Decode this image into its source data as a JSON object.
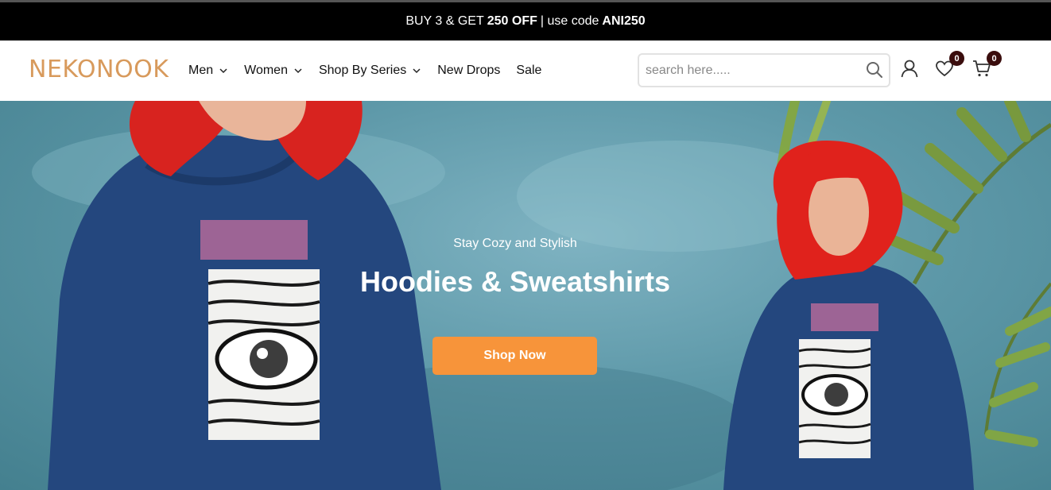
{
  "announcement": {
    "part1": "BUY 3 & GET",
    "bold1": "250 OFF",
    "part2": "| use code",
    "bold2": "ANI250"
  },
  "brand": {
    "logo_text": "NEKONOOK",
    "logo_color": "#d89a5c"
  },
  "nav": {
    "items": [
      {
        "label": "Men",
        "has_dropdown": true
      },
      {
        "label": "Women",
        "has_dropdown": true
      },
      {
        "label": "Shop By Series",
        "has_dropdown": true
      },
      {
        "label": "New Drops",
        "has_dropdown": false
      },
      {
        "label": "Sale",
        "has_dropdown": false
      }
    ]
  },
  "search": {
    "placeholder": "search here.....",
    "value": ""
  },
  "header_icons": {
    "account": "user-icon",
    "wishlist": {
      "icon": "heart-icon",
      "count": "0"
    },
    "cart": {
      "icon": "cart-icon",
      "count": "0"
    }
  },
  "hero": {
    "tagline": "Stay Cozy and Stylish",
    "headline": "Hoodies & Sweatshirts",
    "cta_label": "Shop Now",
    "cta_color": "#f7943a"
  }
}
